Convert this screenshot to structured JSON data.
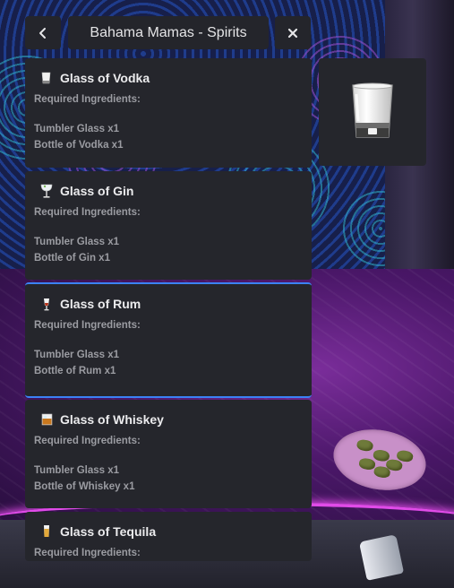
{
  "header": {
    "back_icon": "chevron-left-icon",
    "title": "Bahama Mamas - Spirits",
    "close_icon": "close-icon"
  },
  "items": [
    {
      "name": "Glass of Vodka",
      "icon": "vodka-glass-icon",
      "required_label": "Required Ingredients:",
      "ingredients": [
        "Tumbler Glass x1",
        "Bottle of Vodka x1"
      ]
    },
    {
      "name": "Glass of Gin",
      "icon": "gin-glass-icon",
      "required_label": "Required Ingredients:",
      "ingredients": [
        "Tumbler Glass x1",
        "Bottle of Gin x1"
      ]
    },
    {
      "name": "Glass of Rum",
      "icon": "rum-glass-icon",
      "required_label": "Required Ingredients:",
      "ingredients": [
        "Tumbler Glass x1",
        "Bottle of Rum x1"
      ]
    },
    {
      "name": "Glass of Whiskey",
      "icon": "whiskey-glass-icon",
      "required_label": "Required Ingredients:",
      "ingredients": [
        "Tumbler Glass x1",
        "Bottle of Whiskey x1"
      ]
    },
    {
      "name": "Glass of Tequila",
      "icon": "tequila-glass-icon",
      "required_label": "Required Ingredients:",
      "ingredients": []
    }
  ],
  "preview": {
    "icon": "vodka-glass-preview-icon"
  },
  "colors": {
    "panel": "#25262c",
    "selection": "#3b82f6",
    "text": "#ebebed",
    "muted": "#9b9ca2"
  }
}
